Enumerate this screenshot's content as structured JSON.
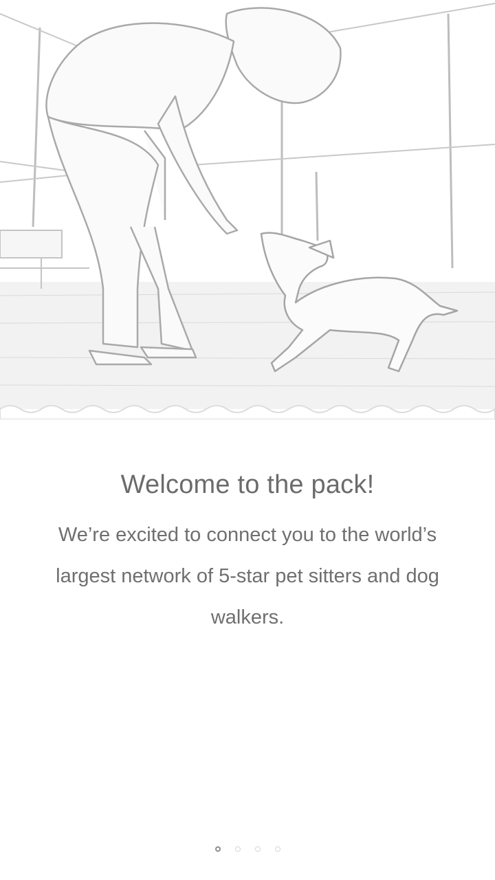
{
  "onboarding": {
    "hero_image": "person-training-dog-in-park",
    "title": "Welcome to the pack!",
    "body": "We’re excited to connect you to the world’s largest network of 5-star pet sitters and dog walkers.",
    "page_count": 4,
    "active_page": 1,
    "colors": {
      "background": "#ffffff",
      "title": "#6b6b6b",
      "body": "#6f6f6f",
      "dot_active": "#8e8e8e",
      "dot_inactive": "#d6d6d6"
    }
  }
}
